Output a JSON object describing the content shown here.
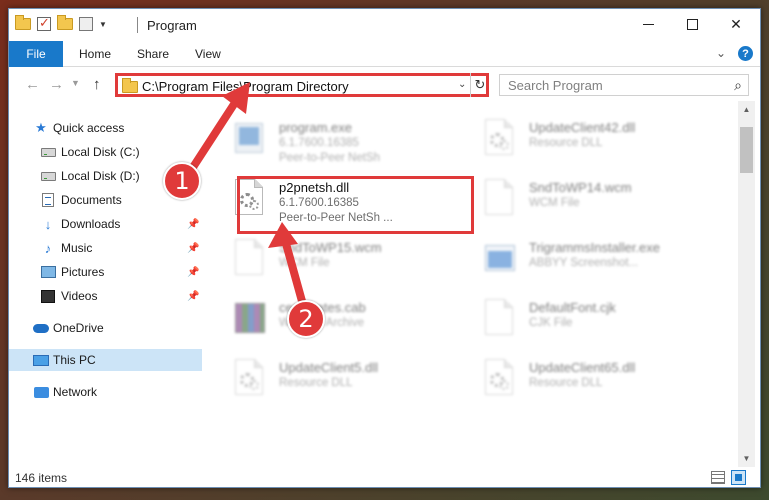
{
  "window": {
    "title": "Program"
  },
  "ribbon": {
    "tabs": [
      "File",
      "Home",
      "Share",
      "View"
    ]
  },
  "navbar": {
    "address": "C:\\Program Files\\Program Directory",
    "search_placeholder": "Search Program"
  },
  "sidebar": {
    "items": [
      {
        "label": "Quick access",
        "icon": "star-icon",
        "pinned": false
      },
      {
        "label": "Local Disk (C:)",
        "icon": "drive-icon",
        "pinned": false
      },
      {
        "label": "Local Disk (D:)",
        "icon": "drive-icon",
        "pinned": false
      },
      {
        "label": "Documents",
        "icon": "documents-icon",
        "pinned": false
      },
      {
        "label": "Downloads",
        "icon": "download-arrow-icon",
        "pinned": true
      },
      {
        "label": "Music",
        "icon": "music-note-icon",
        "pinned": true
      },
      {
        "label": "Pictures",
        "icon": "pictures-icon",
        "pinned": true
      },
      {
        "label": "Videos",
        "icon": "videos-icon",
        "pinned": true
      },
      {
        "label": "OneDrive",
        "icon": "cloud-icon",
        "pinned": false
      },
      {
        "label": "This PC",
        "icon": "computer-icon",
        "pinned": false,
        "selected": true
      },
      {
        "label": "Network",
        "icon": "network-icon",
        "pinned": false
      }
    ]
  },
  "files": [
    {
      "name": "program.exe",
      "meta1": "6.1.7600.16385",
      "meta2": "Peer-to-Peer NetSh",
      "icon": "exe-icon"
    },
    {
      "name": "UpdateClient42.dll",
      "meta1": "Resource DLL",
      "meta2": "",
      "icon": "dll-gear-icon"
    },
    {
      "name": "p2pnetsh.dll",
      "meta1": "6.1.7600.16385",
      "meta2": "Peer-to-Peer NetSh ...",
      "icon": "dll-gear-icon"
    },
    {
      "name": "SndToWP14.wcm",
      "meta1": "WCM File",
      "meta2": "",
      "icon": "blank-file-icon"
    },
    {
      "name": "SndToWP15.wcm",
      "meta1": "WCM File",
      "meta2": "",
      "icon": "blank-file-icon"
    },
    {
      "name": "TrigrammsInstaller.exe",
      "meta1": "ABBYY Screenshot...",
      "meta2": "",
      "icon": "installer-icon"
    },
    {
      "name": "certificates.cab",
      "meta1": "WinRAR Archive",
      "meta2": "",
      "icon": "archive-icon"
    },
    {
      "name": "DefaultFont.cjk",
      "meta1": "CJK File",
      "meta2": "",
      "icon": "blank-file-icon"
    },
    {
      "name": "UpdateClient5.dll",
      "meta1": "Resource DLL",
      "meta2": "",
      "icon": "dll-gear-icon"
    },
    {
      "name": "UpdateClient65.dll",
      "meta1": "Resource DLL",
      "meta2": "",
      "icon": "dll-gear-icon"
    }
  ],
  "annotations": {
    "step1": "1",
    "step2": "2",
    "color": "#e03a3a"
  },
  "status": {
    "items_count": "146 items"
  }
}
